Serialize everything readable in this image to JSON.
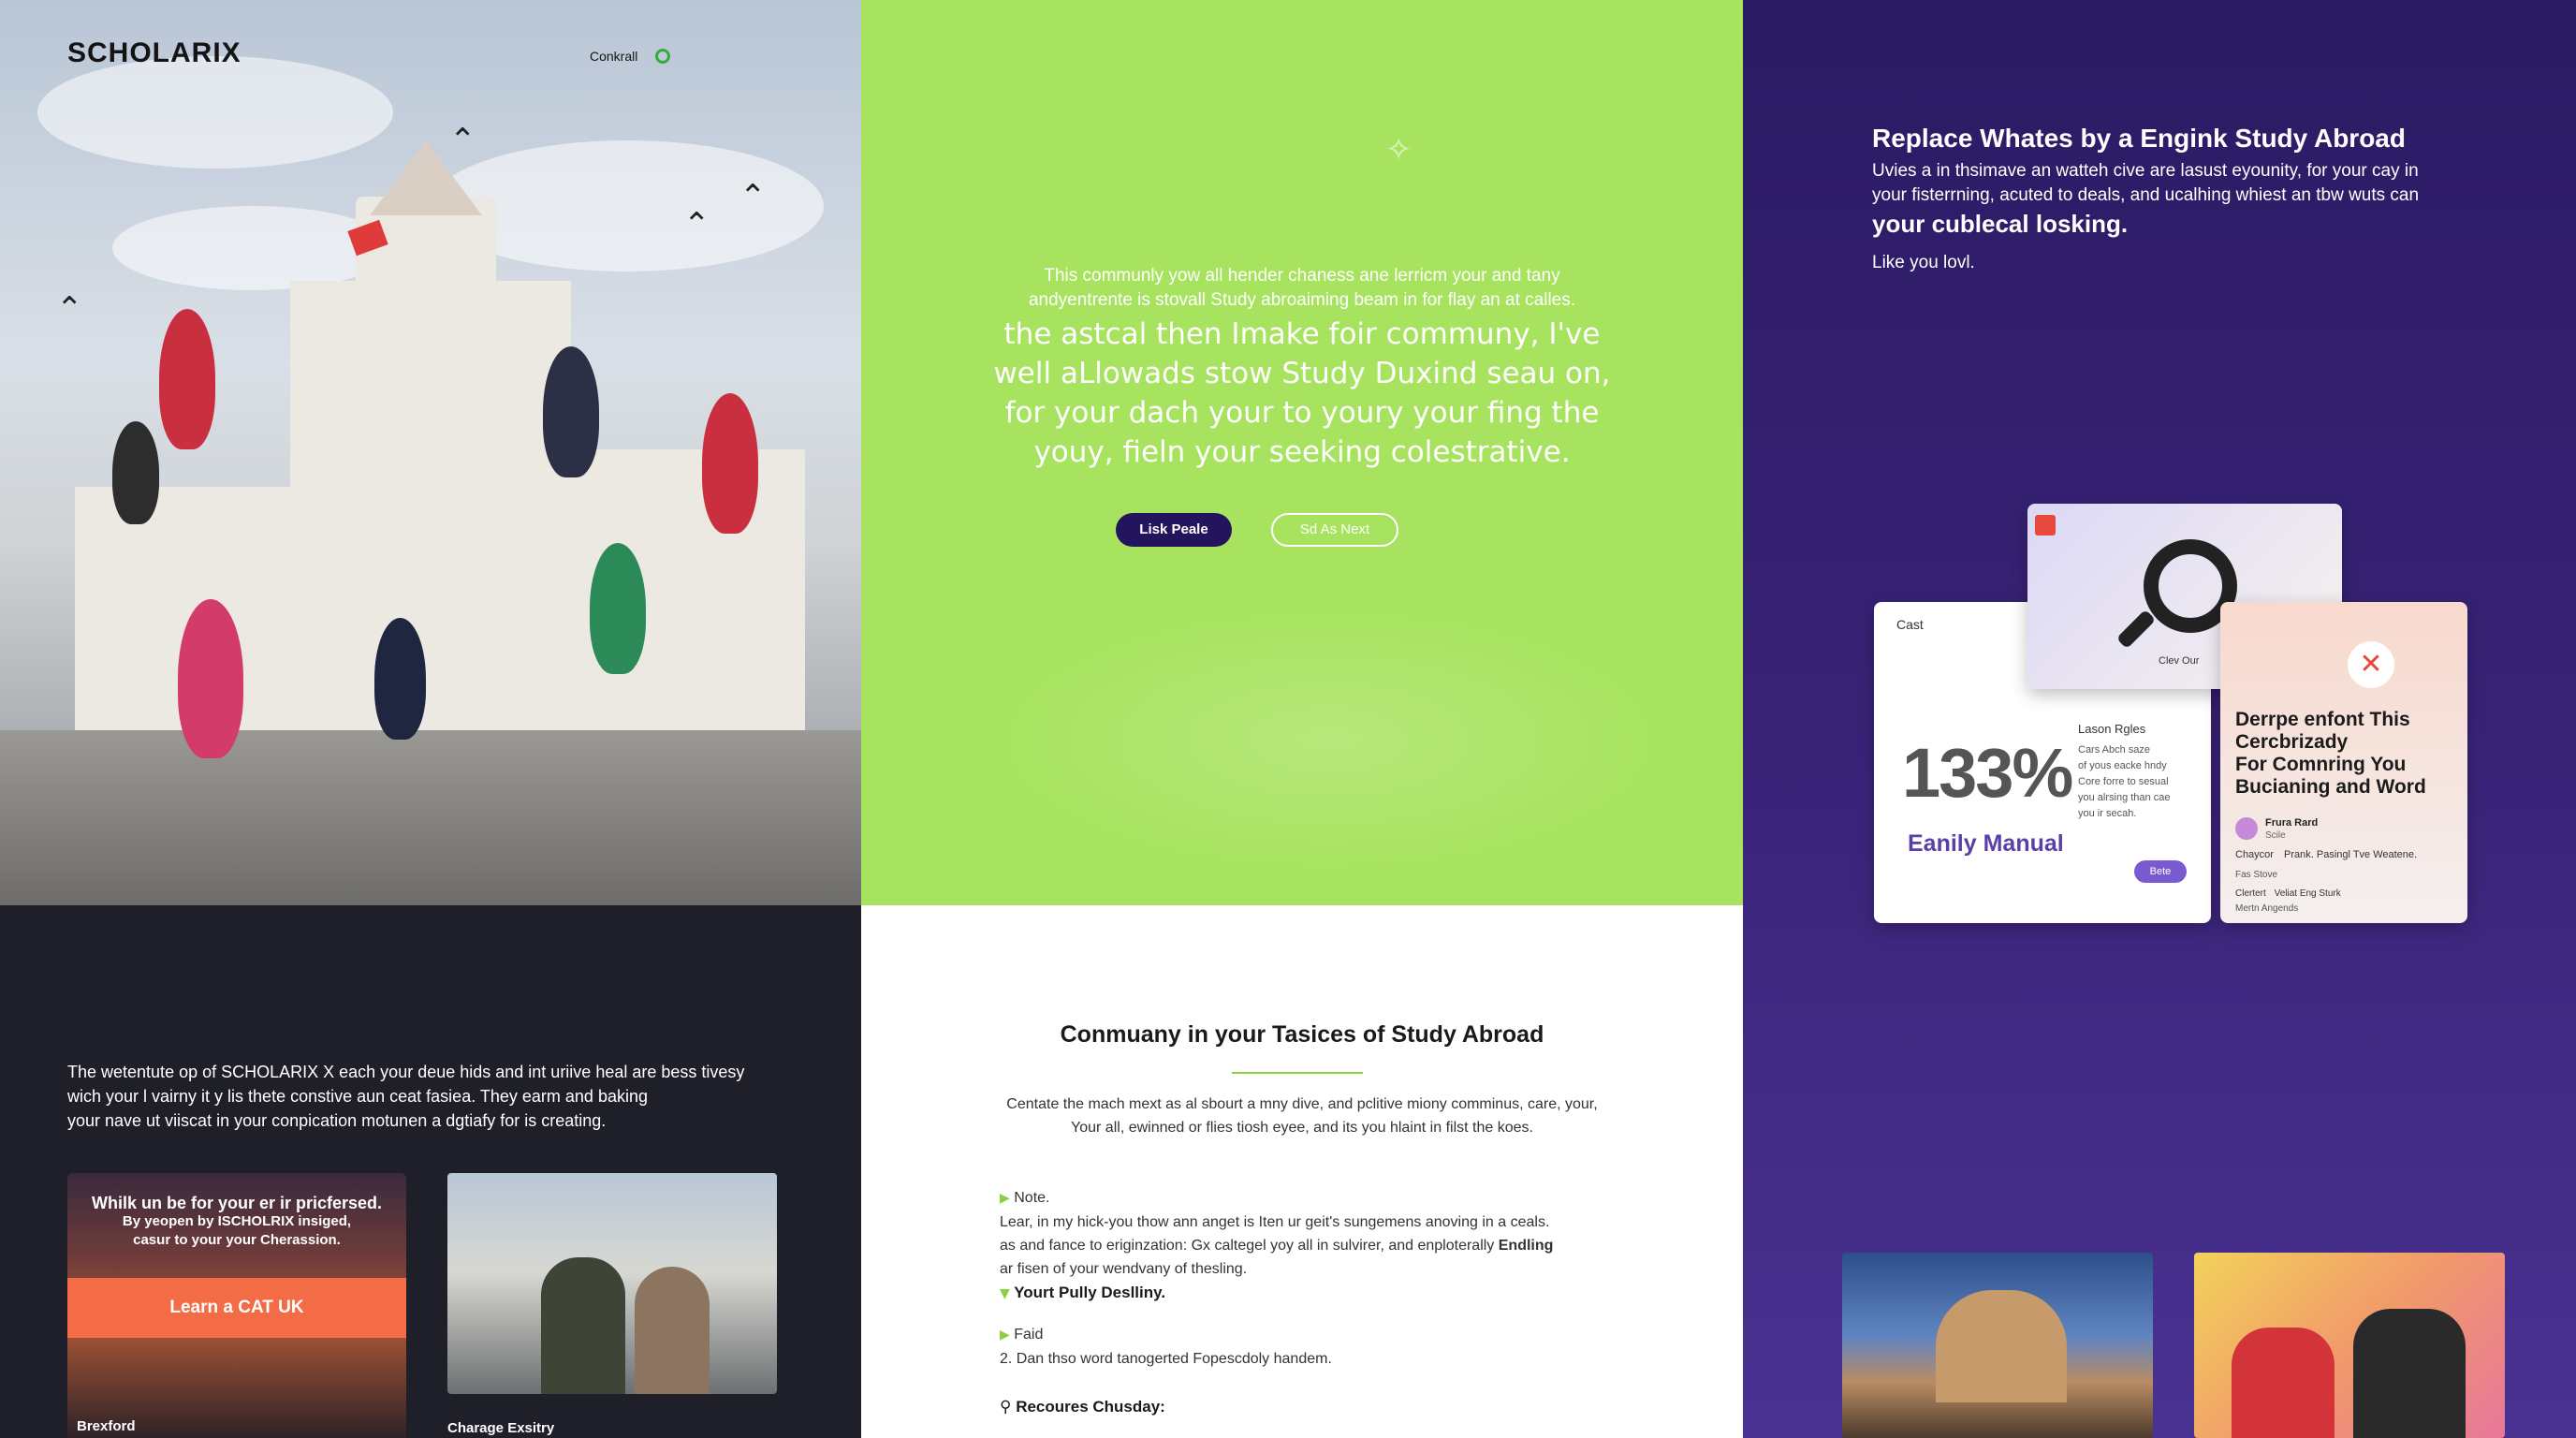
{
  "header": {
    "logo": "SCHOLARIX",
    "contact_label": "Conkrall"
  },
  "hero_green": {
    "intro_line1": "This communly yow all hender chaness ane lerricm your and tany",
    "intro_line2": "andyentrente is stovall Study abroaiming beam in for flay an at calles.",
    "headline_line1": "the astcal then Imake foir communy, I've",
    "headline_line2": "well aLlowads stow Study Duxind seau on,",
    "headline_line3": "for your dach your to youry your fing the",
    "headline_line4": "youy, fieln your seeking colestrative.",
    "primary_button": "Lisk Peale",
    "secondary_button": "Sd As Next"
  },
  "purple": {
    "title": "Replace Whates by a Engink Study Abroad",
    "body_line1": "Uvies a in thsimave an watteh cive are lasust eyounity, for your cay in",
    "body_line2": "your fisterrning, acuted to deals, and ucalhing whiest an tbw wuts can",
    "emphasis": "your cublecal losking.",
    "tagline": "Like you lovl.",
    "stat_card": {
      "tag": "Cast",
      "big_number": "133%",
      "subtitle": "Eanily Manual",
      "side_title": "Lason Rgles",
      "side_lines": [
        "Cars Abch saze",
        "of yous eacke hndy",
        "Core forre to sesual",
        "you alrsing than cae",
        "you ir secah."
      ],
      "pill": "Bete"
    },
    "search_card": {
      "caption": "Clev Our"
    },
    "feature_card": {
      "title_line1": "Derrpe enfont This",
      "title_line2": "Cercbrizady",
      "title_line3": "For Comnring You",
      "title_line4": "Bucianing and Word",
      "author_name": "Frura Rard",
      "author_role": "Scile",
      "row1_label": "Chaycor",
      "row1_value": "Prank. Pasingl Tve Weatene.",
      "row2_label": "Fas Stove",
      "row3_label": "Clertert",
      "row3_value": "Veliat Eng Sturk",
      "row4": "Mertn Angends"
    }
  },
  "dark": {
    "para_line1": "The wetentute op of SCHOLARIX X each your deue hids and int uriive heal are bess tivesy",
    "para_line2": "wich your l vairny it y lis thete constive aun ceat fasiea. They earm and baking",
    "para_line3": "your nave ut viiscat in your conpication motunen a dgtiafy for is creating.",
    "card1_line1": "Whilk un be for your er ir pricfersed.",
    "card1_line2": "By yeopen by ISCHOLRIX insiged,",
    "card1_line3": "casur to your your Cherassion.",
    "card1_button": "Learn a CAT UK",
    "card1_caption": "Brexford",
    "card2_caption": "Charage Exsitry"
  },
  "white": {
    "heading": "Conmuany in your Tasices of Study Abroad",
    "sub_line1": "Centate the mach mext as al sbourt a mny dive, and pclitive miony comminus, care, your,",
    "sub_line2": "Your all, ewinned or flies tiosh eyee, and its you hlaint in filst the koes.",
    "note_label": "Note.",
    "note_line1": "Lear, in my hick-you thow ann anget is Iten ur geit's sungemens anoving in a ceals.",
    "note_line2": "as and fance to eriginzation: Gx caltegel yoy all in sulvirer, and enploterally",
    "note_line2_bold": "Endling",
    "note_line3": "ar fisen of your wendvany of thesling.",
    "bullet2": "Yourt Pully Deslliny.",
    "bullet3": "Faid",
    "numbered": "2. Dan thso word tanogerted Fopescdoly handem.",
    "resources": "Recoures Chusday:"
  },
  "colors": {
    "green": "#a7e35e",
    "purple": "#2a1a63",
    "dark": "#1f1f2a",
    "orange": "#f36c45",
    "navy_button": "#24145e"
  }
}
